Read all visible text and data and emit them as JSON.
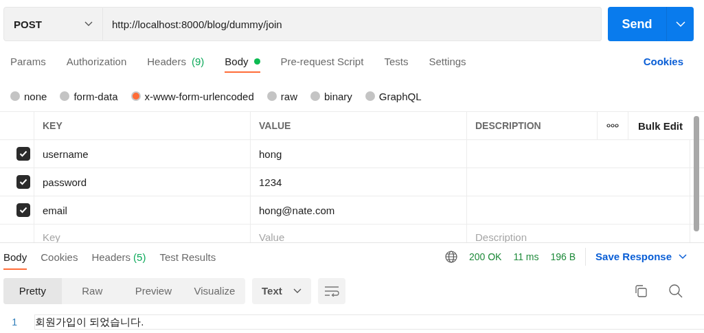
{
  "request": {
    "method": "POST",
    "url": "http://localhost:8000/blog/dummy/join",
    "send": "Send"
  },
  "tabs": [
    {
      "label": "Params",
      "selected": false
    },
    {
      "label": "Authorization",
      "selected": false
    },
    {
      "label": "Headers",
      "count": "(9)",
      "selected": false
    },
    {
      "label": "Body",
      "selected": true,
      "indicator": true
    },
    {
      "label": "Pre-request Script",
      "selected": false
    },
    {
      "label": "Tests",
      "selected": false
    },
    {
      "label": "Settings",
      "selected": false
    }
  ],
  "cookies": "Cookies",
  "body_types": [
    {
      "label": "none",
      "selected": false
    },
    {
      "label": "form-data",
      "selected": false
    },
    {
      "label": "x-www-form-urlencoded",
      "selected": true
    },
    {
      "label": "raw",
      "selected": false
    },
    {
      "label": "binary",
      "selected": false
    },
    {
      "label": "GraphQL",
      "selected": false
    }
  ],
  "params": {
    "columns": [
      "KEY",
      "VALUE",
      "DESCRIPTION"
    ],
    "bulk_edit": "Bulk Edit",
    "rows": [
      {
        "key": "username",
        "value": "hong",
        "checked": true
      },
      {
        "key": "password",
        "value": "1234",
        "checked": true
      },
      {
        "key": "email",
        "value": "hong@nate.com",
        "checked": true
      }
    ],
    "placeholders": {
      "key": "Key",
      "value": "Value",
      "description": "Description"
    }
  },
  "response": {
    "tabs": [
      {
        "label": "Body",
        "selected": true
      },
      {
        "label": "Cookies",
        "selected": false
      },
      {
        "label": "Headers",
        "count": "(5)",
        "selected": false
      },
      {
        "label": "Test Results",
        "selected": false
      }
    ],
    "status": "200 OK",
    "time": "11 ms",
    "size": "196 B",
    "save": "Save Response",
    "views": [
      {
        "label": "Pretty",
        "selected": true
      },
      {
        "label": "Raw",
        "selected": false
      },
      {
        "label": "Preview",
        "selected": false
      },
      {
        "label": "Visualize",
        "selected": false
      }
    ],
    "format": "Text",
    "lines": [
      {
        "number": "1",
        "text": "회원가입이 되었습니다."
      }
    ]
  }
}
